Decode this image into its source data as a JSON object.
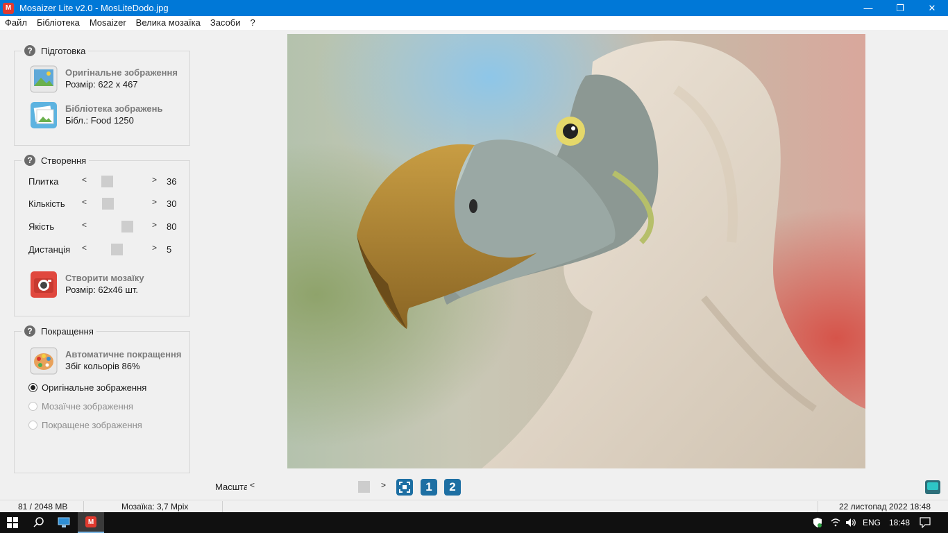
{
  "window": {
    "title": "Mosaizer Lite v2.0 - MosLiteDodo.jpg",
    "minimize": "—",
    "maximize": "❐",
    "close": "✕"
  },
  "menu": [
    "Файл",
    "Бібліотека",
    "Mosaizer",
    "Велика мозаїка",
    "Засоби",
    "?"
  ],
  "prep": {
    "title": "Підготовка",
    "original": {
      "name": "Оригінальне зображення",
      "sub": "Розмір: 622 x 467"
    },
    "library": {
      "name": "Бібліотека зображень",
      "sub": "Бібл.: Food 1250"
    }
  },
  "create": {
    "title": "Створення",
    "sliders": [
      {
        "label": "Плитка",
        "value": "36",
        "level": 0.25
      },
      {
        "label": "Кількість",
        "value": "30",
        "level": 0.27
      },
      {
        "label": "Якість",
        "value": "80",
        "level": 0.66
      },
      {
        "label": "Дистанція",
        "value": "5",
        "level": 0.45
      }
    ],
    "make": {
      "name": "Створити мозаїку",
      "sub": "Розмір: 62x46 шт."
    }
  },
  "improve": {
    "title": "Покращення",
    "auto": {
      "name": "Автоматичне покращення",
      "sub": "Збіг кольорів 86%"
    },
    "options": [
      {
        "label": "Оригінальне зображення",
        "checked": true,
        "enabled": true
      },
      {
        "label": "Мозаїчне зображення",
        "checked": false,
        "enabled": false
      },
      {
        "label": "Покращене зображення",
        "checked": false,
        "enabled": false
      }
    ]
  },
  "zoom": {
    "label": "Масштаб",
    "level": 0.62,
    "btn1": "1",
    "btn2": "2"
  },
  "status": {
    "memory": "81 / 2048 MB",
    "mosaic": "Мозаїка: 3,7 Mpix",
    "date": "22 листопад 2022",
    "time": "18:48"
  },
  "taskbar": {
    "lang": "ENG",
    "time": "18:48"
  },
  "colors": {
    "titlebar": "#0078d7",
    "taskbar": "#101010"
  }
}
